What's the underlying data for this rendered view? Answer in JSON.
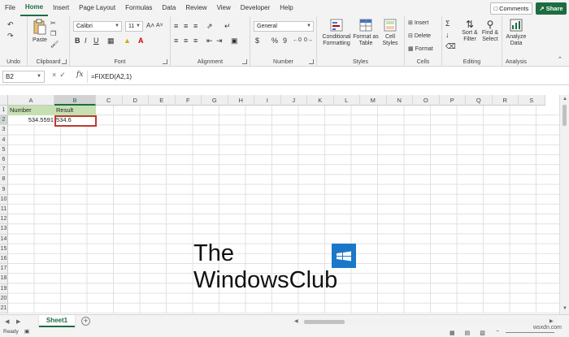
{
  "menu": {
    "tabs": [
      "File",
      "Home",
      "Insert",
      "Page Layout",
      "Formulas",
      "Data",
      "Review",
      "View",
      "Developer",
      "Help"
    ],
    "active": "Home",
    "comments_label": "Comments",
    "share_label": "Share"
  },
  "ribbon": {
    "undo_group": "Undo",
    "clipboard": {
      "paste": "Paste",
      "group": "Clipboard"
    },
    "font": {
      "name": "Calibri",
      "size": "11",
      "bold": "B",
      "italic": "I",
      "underline": "U",
      "group": "Font"
    },
    "alignment": {
      "group": "Alignment"
    },
    "number": {
      "format": "General",
      "group": "Number",
      "currency": "$",
      "percent": "%",
      "comma": "9"
    },
    "styles": {
      "conditional_line1": "Conditional",
      "conditional_line2": "Formatting",
      "format_table_line1": "Format as",
      "format_table_line2": "Table",
      "cell_styles_line1": "Cell",
      "cell_styles_line2": "Styles",
      "group": "Styles"
    },
    "cells": {
      "insert": "Insert",
      "delete": "Delete",
      "format": "Format",
      "group": "Cells"
    },
    "editing": {
      "sort_line1": "Sort &",
      "sort_line2": "Filter",
      "find_line1": "Find &",
      "find_line2": "Select",
      "group": "Editing"
    },
    "analysis": {
      "line1": "Analyze",
      "line2": "Data",
      "group": "Analysis"
    }
  },
  "formula_bar": {
    "name_box": "B2",
    "fx": "fx",
    "formula": "=FIXED(A2,1)"
  },
  "columns": [
    "A",
    "B",
    "C",
    "D",
    "E",
    "F",
    "G",
    "H",
    "I",
    "J",
    "K",
    "L",
    "M",
    "N",
    "O",
    "P",
    "Q",
    "R",
    "S"
  ],
  "rows": [
    "1",
    "2",
    "3",
    "4",
    "5",
    "6",
    "7",
    "8",
    "9",
    "10",
    "11",
    "12",
    "13",
    "14",
    "15",
    "16",
    "17",
    "18",
    "19",
    "20",
    "21"
  ],
  "cells": {
    "a1": "Number",
    "b1": "Result",
    "a2": "534.5591",
    "b2": "534.6"
  },
  "selected_cell": "B2",
  "sheet": {
    "name": "Sheet1"
  },
  "status": {
    "ready": "Ready"
  },
  "watermark": {
    "line1": "The",
    "line2": "WindowsClub",
    "domain": "wsxdn.com"
  },
  "colors": {
    "accent": "#1e6c41",
    "header_fill": "#c6e0b4",
    "selection_border": "#c0392b",
    "logo_blue": "#1b78c8"
  }
}
